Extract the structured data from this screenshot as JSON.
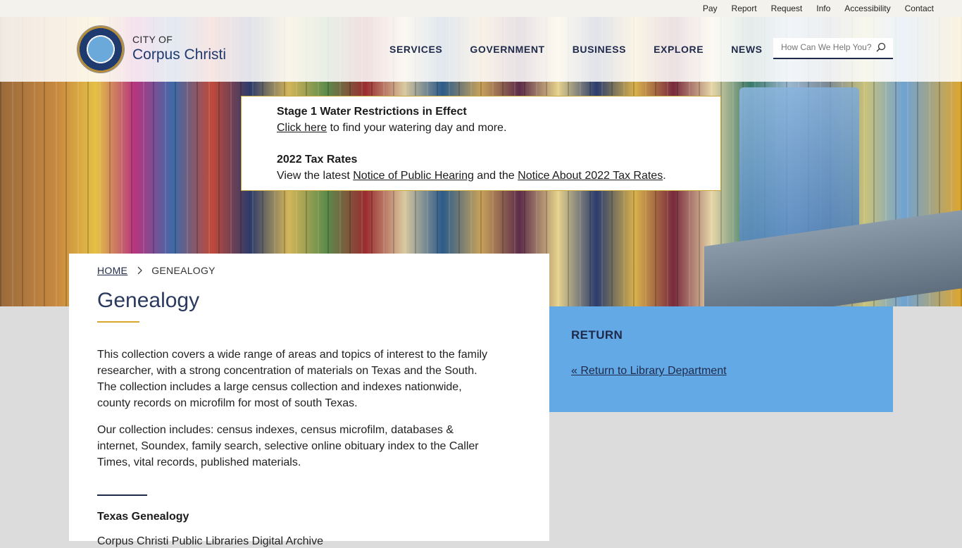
{
  "utility_nav": [
    "Pay",
    "Report",
    "Request",
    "Info",
    "Accessibility",
    "Contact"
  ],
  "header": {
    "city_of": "CITY OF",
    "city_name": "Corpus Christi",
    "nav": [
      "SERVICES",
      "GOVERNMENT",
      "BUSINESS",
      "EXPLORE",
      "NEWS"
    ],
    "search_placeholder": "How Can We Help You?"
  },
  "alert": {
    "title1": "Stage 1 Water Restrictions in Effect",
    "link1": "Click here",
    "text1": " to find your watering day and more.",
    "title2": "2022 Tax Rates",
    "text2a": "View the latest ",
    "link2": "Notice of Public Hearing",
    "text2b": " and the ",
    "link3": "Notice About 2022 Tax Rates",
    "text2c": "."
  },
  "breadcrumb": {
    "home": "HOME",
    "current": "GENEALOGY"
  },
  "page": {
    "title": "Genealogy",
    "para1": "This collection covers a wide range of areas and topics of interest to the family researcher, with a strong concentration of materials on Texas and the South. The collection includes a large census collection and indexes nationwide, county records on microfilm for most of south Texas.",
    "para2": "Our collection includes: census indexes, census microfilm, databases & internet, Soundex, family search, selective online obituary index to the Caller Times, vital records, published materials.",
    "section_title": "Texas Genealogy",
    "cut_text": "Corpus Christi Public Libraries Digital Archive"
  },
  "sidebar": {
    "heading": "RETURN",
    "link": "« Return to Library Department"
  },
  "colors": {
    "navy": "#1f2a4a",
    "gold": "#d9a72c",
    "sidebar_blue": "#62a9e6",
    "background": "#dcdcdc"
  },
  "icons": [
    "search-icon",
    "chevron-right-icon",
    "city-seal-logo"
  ]
}
